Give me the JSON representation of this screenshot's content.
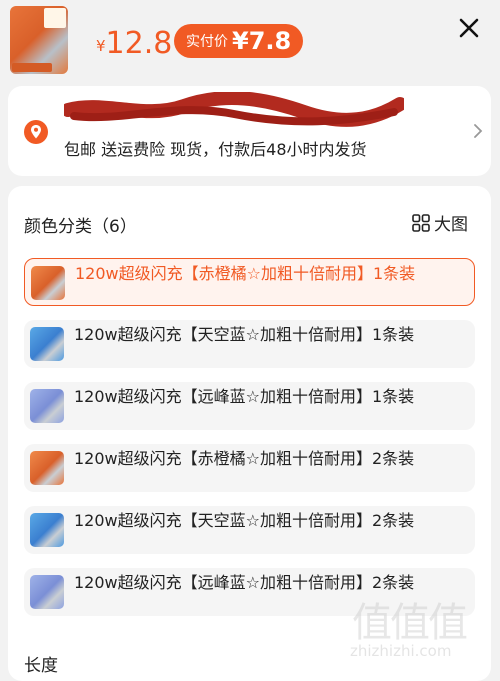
{
  "header": {
    "currency": "¥",
    "price": "12.8",
    "pay_label": "实付价",
    "pay_currency": "¥",
    "pay_price": "7.8",
    "close_icon": "close-icon"
  },
  "address": {
    "icon": "location-pin-icon",
    "shipping_info": "包邮  送运费险  现货，付款后48小时内发货"
  },
  "options": {
    "title": "颜色分类（6）",
    "big_view_label": "大图",
    "items": [
      {
        "label": "120w超级闪充【赤橙橘☆加粗十倍耐用】1条装",
        "selected": true,
        "color": "orange"
      },
      {
        "label": "120w超级闪充【天空蓝☆加粗十倍耐用】1条装",
        "selected": false,
        "color": "sky"
      },
      {
        "label": "120w超级闪充【远峰蓝☆加粗十倍耐用】1条装",
        "selected": false,
        "color": "peak"
      },
      {
        "label": "120w超级闪充【赤橙橘☆加粗十倍耐用】2条装",
        "selected": false,
        "color": "orange"
      },
      {
        "label": "120w超级闪充【天空蓝☆加粗十倍耐用】2条装",
        "selected": false,
        "color": "sky"
      },
      {
        "label": "120w超级闪充【远峰蓝☆加粗十倍耐用】2条装",
        "selected": false,
        "color": "peak"
      }
    ]
  },
  "length": {
    "title": "长度"
  },
  "watermark": {
    "glyphs": "值值值",
    "url": "zhizhizhi.com"
  },
  "colors": {
    "accent": "#f15a24",
    "selected_bg": "#fff3ee",
    "page_bg": "#f2f2f2"
  }
}
